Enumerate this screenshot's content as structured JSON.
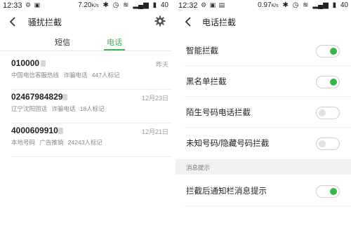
{
  "left": {
    "status": {
      "time": "12:33",
      "battery_text": "7.20",
      "battery_unit": "K/s",
      "signal_text": "40"
    },
    "nav": {
      "title": "骚扰拦截"
    },
    "tabs": [
      {
        "label": "短信",
        "active": false
      },
      {
        "label": "电话",
        "active": true
      }
    ],
    "records": [
      {
        "number": "010000",
        "date": "昨天",
        "location": "中国电信客服热线",
        "type": "诈骗电话",
        "marks": "447人标记"
      },
      {
        "number": "02467984829",
        "date": "12月23日",
        "location": "辽宁沈阳固话",
        "type": "诈骗电话",
        "marks": "18人标记"
      },
      {
        "number": "4000609910",
        "date": "12月21日",
        "location": "本地号码",
        "type": "广告推销",
        "marks": "24243人标记"
      }
    ]
  },
  "right": {
    "status": {
      "time": "12:32",
      "battery_text": "0.97",
      "battery_unit": "K/s",
      "signal_text": "40"
    },
    "nav": {
      "title": "电话拦截"
    },
    "settings": [
      {
        "label": "智能拦截",
        "enabled": true
      },
      {
        "label": "黑名单拦截",
        "enabled": true
      },
      {
        "label": "陌生号码电话拦截",
        "enabled": false
      },
      {
        "label": "未知号码/隐藏号码拦截",
        "enabled": false
      }
    ],
    "section_header": "消息提示",
    "notify_setting": {
      "label": "拦截后通知栏消息提示",
      "enabled": true
    }
  },
  "colors": {
    "accent": "#3ab54a",
    "toggle_off_knob": "#e1e1e1",
    "section_bg": "#f2f2f2"
  },
  "icons": {
    "back": "chevron-left-icon",
    "settings": "gear-icon",
    "phone_tag": "phone-tag-icon",
    "status": [
      "notification-icon",
      "photo-icon",
      "bluetooth-icon",
      "clock-icon",
      "wifi-icon",
      "signal-icon",
      "battery-icon"
    ]
  }
}
